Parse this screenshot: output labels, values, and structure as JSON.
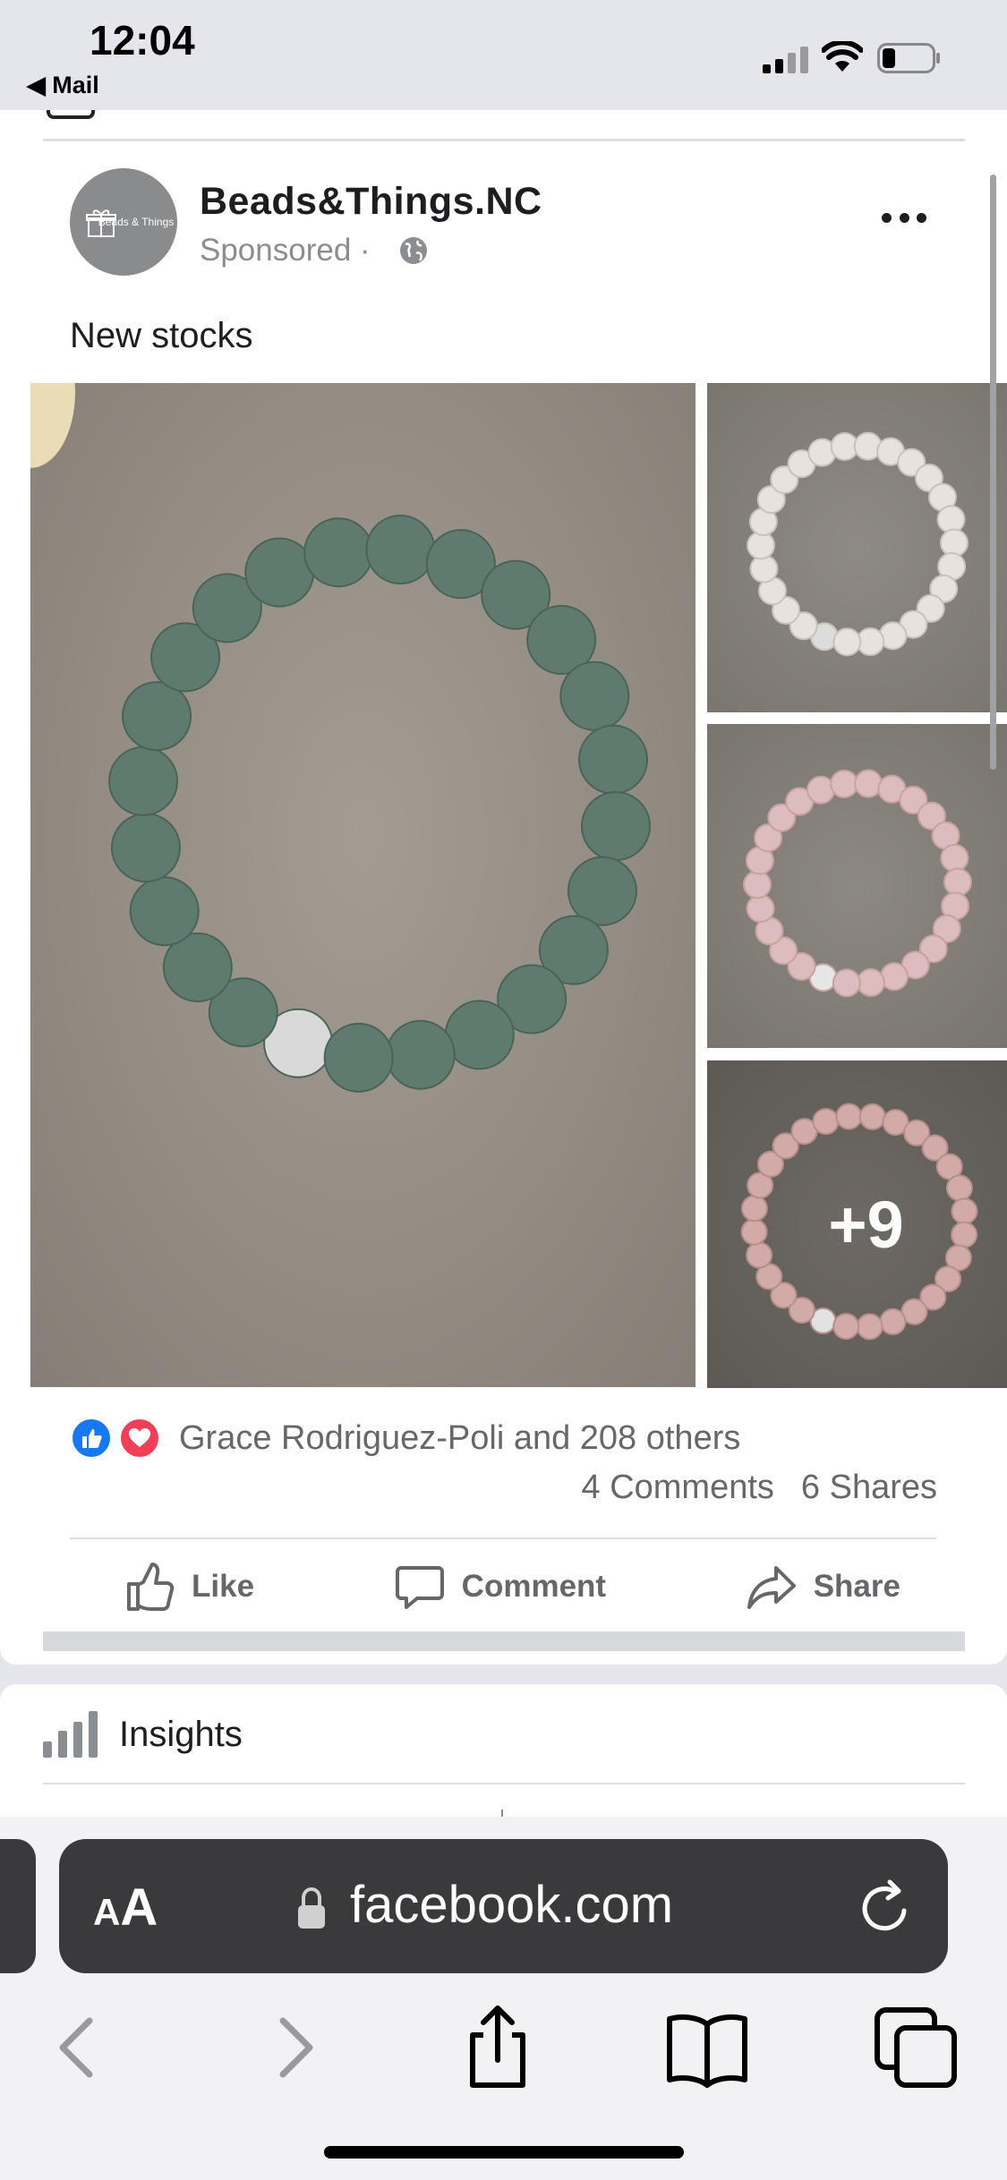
{
  "status_bar": {
    "time": "12:04",
    "back_app": "◀ Mail"
  },
  "post": {
    "page_name": "Beads&Things.NC",
    "sponsored": "Sponsored ·",
    "avatar_text": "Beads & Things",
    "text": "New stocks",
    "more_photos": "+9",
    "reactions_text": "Grace Rodriguez-Poli and 208 others",
    "comments": "4 Comments",
    "shares": "6 Shares",
    "actions": {
      "like": "Like",
      "comment": "Comment",
      "share": "Share"
    }
  },
  "insights": {
    "label": "Insights"
  },
  "browser": {
    "aa_small": "A",
    "aa_big": "A",
    "url": "facebook.com"
  },
  "colors": {
    "like_blue": "#1877f2",
    "love_red": "#f33e58",
    "text_gray": "#65676b",
    "address_bar": "#3a3a3c"
  }
}
